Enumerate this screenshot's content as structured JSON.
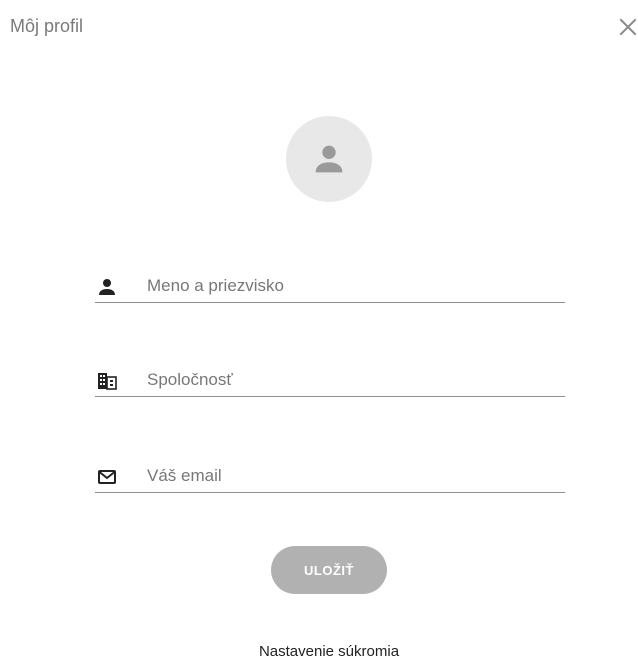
{
  "header": {
    "title": "Môj profil",
    "close_icon": "close-icon"
  },
  "avatar": {
    "icon": "person-icon",
    "background": "#e8e8e8",
    "icon_color": "#9a9a9a"
  },
  "form": {
    "name": {
      "icon": "person-icon",
      "placeholder": "Meno a priezvisko",
      "value": ""
    },
    "company": {
      "icon": "building-icon",
      "placeholder": "Spoločnosť",
      "value": ""
    },
    "email": {
      "icon": "mail-icon",
      "placeholder": "Váš email",
      "value": ""
    }
  },
  "actions": {
    "save_label": "ULOŽIŤ",
    "save_color": "#b1b1b1",
    "privacy_label": "Nastavenie súkromia"
  }
}
